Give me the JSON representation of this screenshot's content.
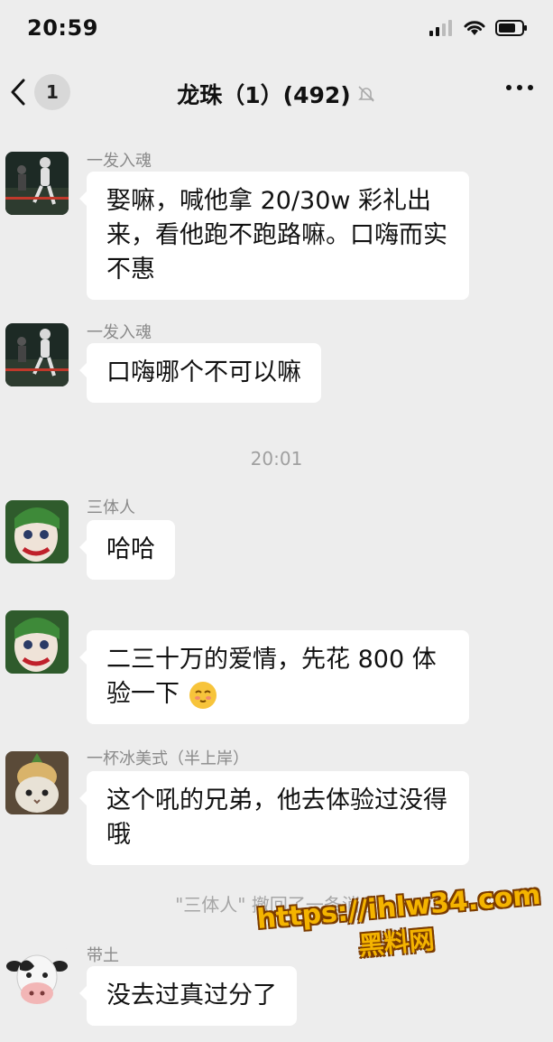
{
  "status_bar": {
    "time": "20:59"
  },
  "nav": {
    "back_count": "1",
    "title": "龙珠（1）(492)"
  },
  "messages": [
    {
      "sender": "一发入魂",
      "text": "娶嘛，喊他拿 20/30w 彩礼出来，看他跑不跑路嘛。口嗨而实不惠"
    },
    {
      "sender": "一发入魂",
      "text": "口嗨哪个不可以嘛"
    },
    {
      "sender": "三体人",
      "text": "哈哈"
    },
    {
      "sender": "",
      "text": "二三十万的爱情，先花 800 体验一下"
    },
    {
      "sender": "一杯冰美式（半上岸）",
      "text": "这个吼的兄弟，他去体验过没得哦"
    },
    {
      "sender": "带土",
      "text": "没去过真过分了"
    }
  ],
  "time_separator": "20:01",
  "system_note": "\"三体人\" 撤回了一条消息",
  "watermark": {
    "line1": "https://ihlw34.com",
    "line2": "黑料网"
  },
  "colors": {
    "background": "#ededed",
    "bubble": "#ffffff",
    "meta_text": "#8a8a8a",
    "watermark": "#f4b400"
  },
  "icons": [
    "cellular-signal-icon",
    "wifi-icon",
    "battery-icon",
    "back-chevron-icon",
    "mute-bell-icon",
    "more-dots-icon",
    "blush-emoji-icon"
  ]
}
